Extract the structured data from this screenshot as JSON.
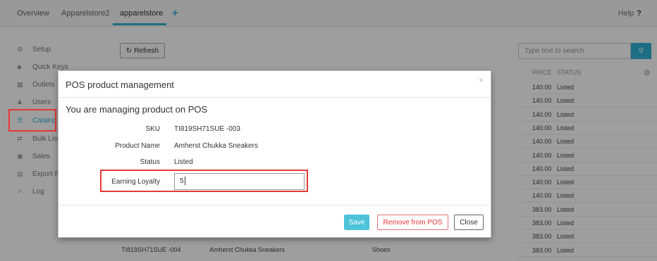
{
  "tabs": [
    {
      "label": "Overview"
    },
    {
      "label": "Apparelstore2"
    },
    {
      "label": "apparelstore"
    }
  ],
  "tab_add_symbol": "+",
  "help": {
    "label": "Help",
    "symbol": "?"
  },
  "sidebar": {
    "items": [
      {
        "label": "Setup",
        "icon": "gear-icon"
      },
      {
        "label": "Quick Keys",
        "icon": "tag-icon"
      },
      {
        "label": "Outlets",
        "icon": "building-icon"
      },
      {
        "label": "Users",
        "icon": "user-icon"
      },
      {
        "label": "Catalog",
        "icon": "list-icon"
      },
      {
        "label": "Bulk Lists",
        "icon": "arrows-icon"
      },
      {
        "label": "Sales",
        "icon": "cart-icon"
      },
      {
        "label": "Export P",
        "icon": "export-icon"
      },
      {
        "label": "Log",
        "icon": "check-icon"
      }
    ]
  },
  "toolbar": {
    "refresh_label": "Refresh"
  },
  "search": {
    "placeholder": "Type text to search"
  },
  "table": {
    "headers": {
      "price": "PRICE",
      "status": "STATUS"
    },
    "rows": [
      {
        "price": "140.00",
        "status": "Listed"
      },
      {
        "price": "140.00",
        "status": "Listed"
      },
      {
        "price": "140.00",
        "status": "Listed"
      },
      {
        "price": "140.00",
        "status": "Listed"
      },
      {
        "price": "140.00",
        "status": "Listed"
      },
      {
        "price": "140.00",
        "status": "Listed"
      },
      {
        "price": "140.00",
        "status": "Listed"
      },
      {
        "price": "140.00",
        "status": "Listed"
      },
      {
        "price": "140.00",
        "status": "Listed"
      },
      {
        "price": "383.00",
        "status": "Listed"
      },
      {
        "price": "383.00",
        "status": "Listed"
      },
      {
        "price": "383.00",
        "status": "Listed"
      },
      {
        "price": "383.00",
        "status": "Listed"
      },
      {
        "price": "383.00",
        "status": "Listed"
      }
    ],
    "bottom_row": {
      "sku": "TI819SH71SUE -004",
      "name": "Amherst Chukka Sneakers",
      "category": "Shoes"
    }
  },
  "modal": {
    "title": "POS product management",
    "subtitle": "You are managing product on POS",
    "fields": {
      "sku_label": "SKU",
      "sku_value": "TI819SH71SUE -003",
      "name_label": "Product Name",
      "name_value": "Amherst Chukka Sneakers",
      "status_label": "Status",
      "status_value": "Listed",
      "loyalty_label": "Earning Loyalty",
      "loyalty_value": "5"
    },
    "buttons": {
      "save": "Save",
      "remove": "Remove from POS",
      "close": "Close"
    },
    "close_symbol": "×"
  },
  "colors": {
    "accent": "#2fb2d6",
    "highlight": "#e53935",
    "save": "#4cc3d9"
  }
}
